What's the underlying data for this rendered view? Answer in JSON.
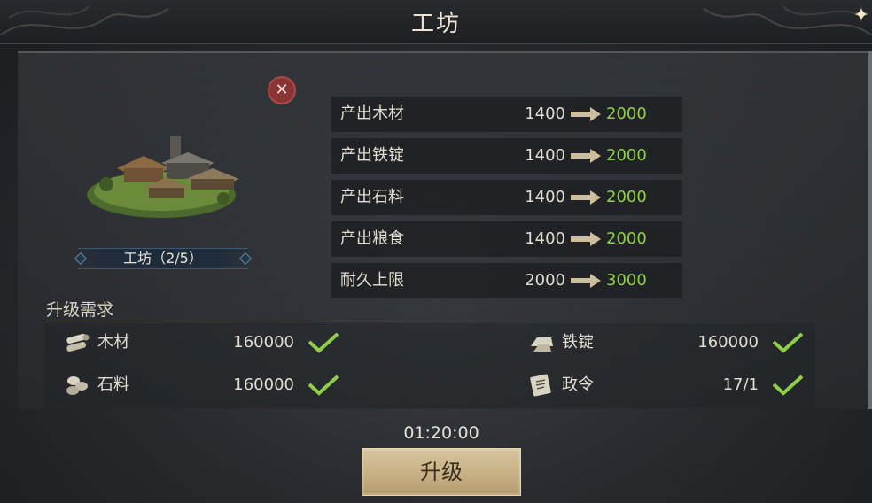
{
  "window": {
    "title": "工坊"
  },
  "building": {
    "name_level": "工坊（2/5）"
  },
  "stats": [
    {
      "label": "产出木材",
      "from": "1400",
      "to": "2000"
    },
    {
      "label": "产出铁锭",
      "from": "1400",
      "to": "2000"
    },
    {
      "label": "产出石料",
      "from": "1400",
      "to": "2000"
    },
    {
      "label": "产出粮食",
      "from": "1400",
      "to": "2000"
    },
    {
      "label": "耐久上限",
      "from": "2000",
      "to": "3000"
    }
  ],
  "requirements": {
    "title": "升级需求",
    "items": [
      {
        "name": "木材",
        "amount": "160000",
        "icon": "wood-icon",
        "met": true
      },
      {
        "name": "铁锭",
        "amount": "160000",
        "icon": "iron-ingot-icon",
        "met": true
      },
      {
        "name": "石料",
        "amount": "160000",
        "icon": "stone-icon",
        "met": true
      },
      {
        "name": "政令",
        "amount": "17/1",
        "icon": "decree-icon",
        "met": true
      }
    ]
  },
  "upgrade": {
    "time": "01:20:00",
    "label": "升级"
  },
  "colors": {
    "increase": "#8fd044",
    "check": "#8fd044",
    "button": "#c9b286"
  }
}
